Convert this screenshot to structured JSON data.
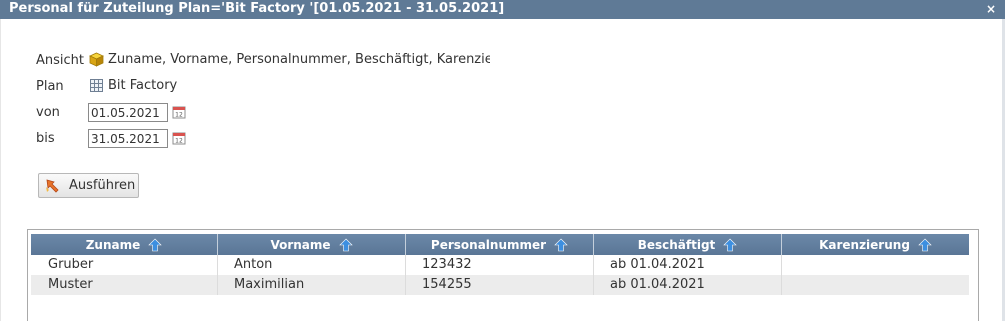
{
  "window": {
    "title": "Personal für Zuteilung Plan='Bit Factory '[01.05.2021 - 31.05.2021]",
    "close_symbol": "×"
  },
  "form": {
    "view_label": "Ansicht",
    "view_icon": "cube-icon",
    "view_value": "Zuname, Vorname, Personalnummer, Beschäftigt, Karenzierung",
    "plan_label": "Plan",
    "plan_icon": "grid-icon",
    "plan_value": "Bit Factory",
    "from_label": "von",
    "from_value": "01.05.2021",
    "to_label": "bis",
    "to_value": "31.05.2021",
    "calendar_icon": "calendar-icon"
  },
  "actions": {
    "run_label": "Ausführen",
    "run_icon": "run-icon"
  },
  "table": {
    "columns": [
      "Zuname",
      "Vorname",
      "Personalnummer",
      "Beschäftigt",
      "Karenzierung"
    ],
    "sort_icon": "sort-up-icon",
    "rows": [
      [
        "Gruber",
        "Anton",
        "123432",
        "ab 01.04.2021",
        ""
      ],
      [
        "Muster",
        "Maximilian",
        "154255",
        "ab 01.04.2021",
        ""
      ]
    ]
  },
  "colors": {
    "titlebar": "#5f7a96",
    "header": "#5f7b9b",
    "sort_arrow": "#3d8fe0",
    "alt_row": "#ececec"
  }
}
